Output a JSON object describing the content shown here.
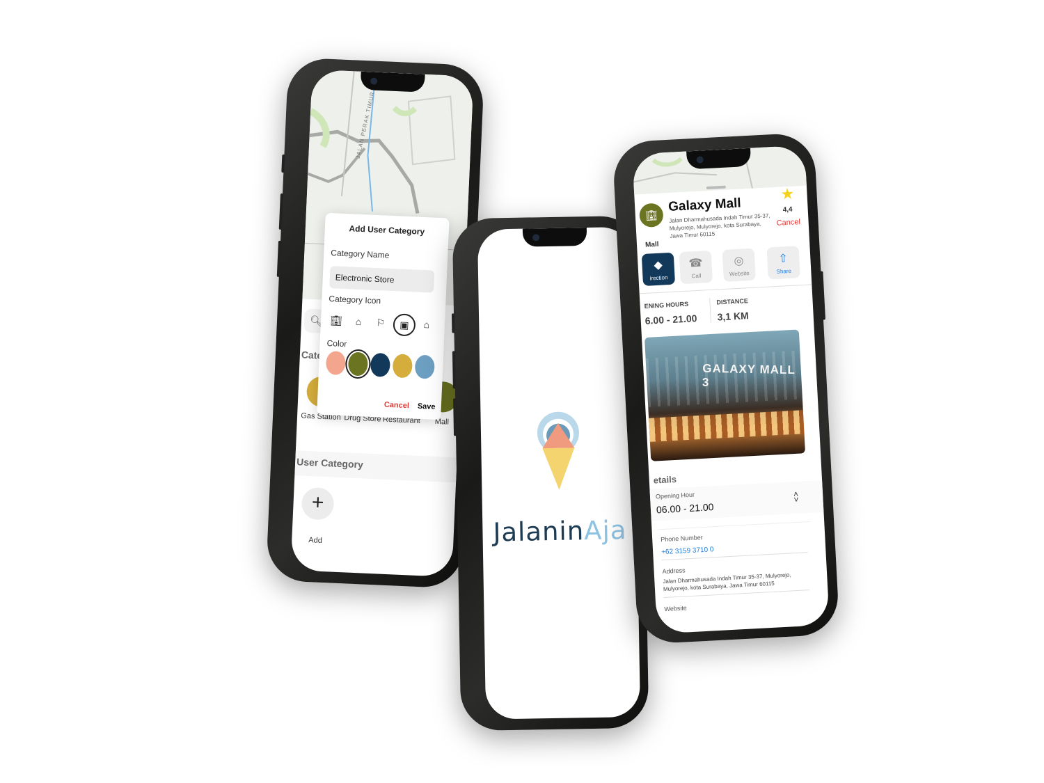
{
  "phone_left": {
    "map": {
      "road_label": "JALAN PERAK TIMUR"
    },
    "dialog": {
      "title": "Add User Category",
      "name_label": "Category Name",
      "name_value": "Electronic Store",
      "icon_label": "Category Icon",
      "icons": [
        "building-icon",
        "house-icon",
        "pin-icon",
        "store-icon",
        "mosque-icon"
      ],
      "selected_icon": "store-icon",
      "color_label": "Color",
      "colors": [
        "#f4a58d",
        "#6b7421",
        "#12385a",
        "#d4ad3c",
        "#6c9fc2"
      ],
      "selected_color": "#6b7421",
      "cancel": "Cancel",
      "save": "Save"
    },
    "categories_title": "Cate",
    "categories": [
      {
        "label": "Gas Station",
        "color": "#d4ad3c"
      },
      {
        "label": "Drug Store",
        "color": "#6c9fc2"
      },
      {
        "label": "Restaurant",
        "color": "#f4a58d"
      },
      {
        "label": "Mall",
        "color": "#6b7421"
      }
    ],
    "user_category_title": "User Category",
    "add_symbol": "+",
    "add_label": "Add"
  },
  "phone_center": {
    "brand_part1": "Jalanin",
    "brand_part2": "Aja"
  },
  "phone_right": {
    "place": {
      "name": "Galaxy Mall",
      "address": "Jalan Dharmahusada Indah Timur 35-37, Mulyorejo, Mulyorejo, kota Surabaya, Jawa Timur 60115",
      "category": "Mall",
      "rating": "4,4",
      "cancel": "Cancel"
    },
    "actions": [
      {
        "label": "irection",
        "icon": "direction-icon"
      },
      {
        "label": "Call",
        "icon": "phone-icon"
      },
      {
        "label": "Website",
        "icon": "globe-icon"
      },
      {
        "label": "Share",
        "icon": "share-icon"
      }
    ],
    "opening_label": "ENING HOURS",
    "opening_value": "6.00 - 21.00",
    "distance_label": "DISTANCE",
    "distance_value": "3,1 KM",
    "photo_sign": "GALAXY MALL 3",
    "details_title": "etails",
    "opening_hour_label": "Opening Hour",
    "opening_hour_value": "06.00 - 21.00",
    "phone_label": "Phone Number",
    "phone_value": "+62 3159 3710 0",
    "address_label": "Address",
    "address_value": "Jalan Dharmahusada Indah Timur 35-37, Mulyorejo, Mulyorejo, kota Surabaya, Jawa Timur 60115",
    "website_label": "Website"
  }
}
